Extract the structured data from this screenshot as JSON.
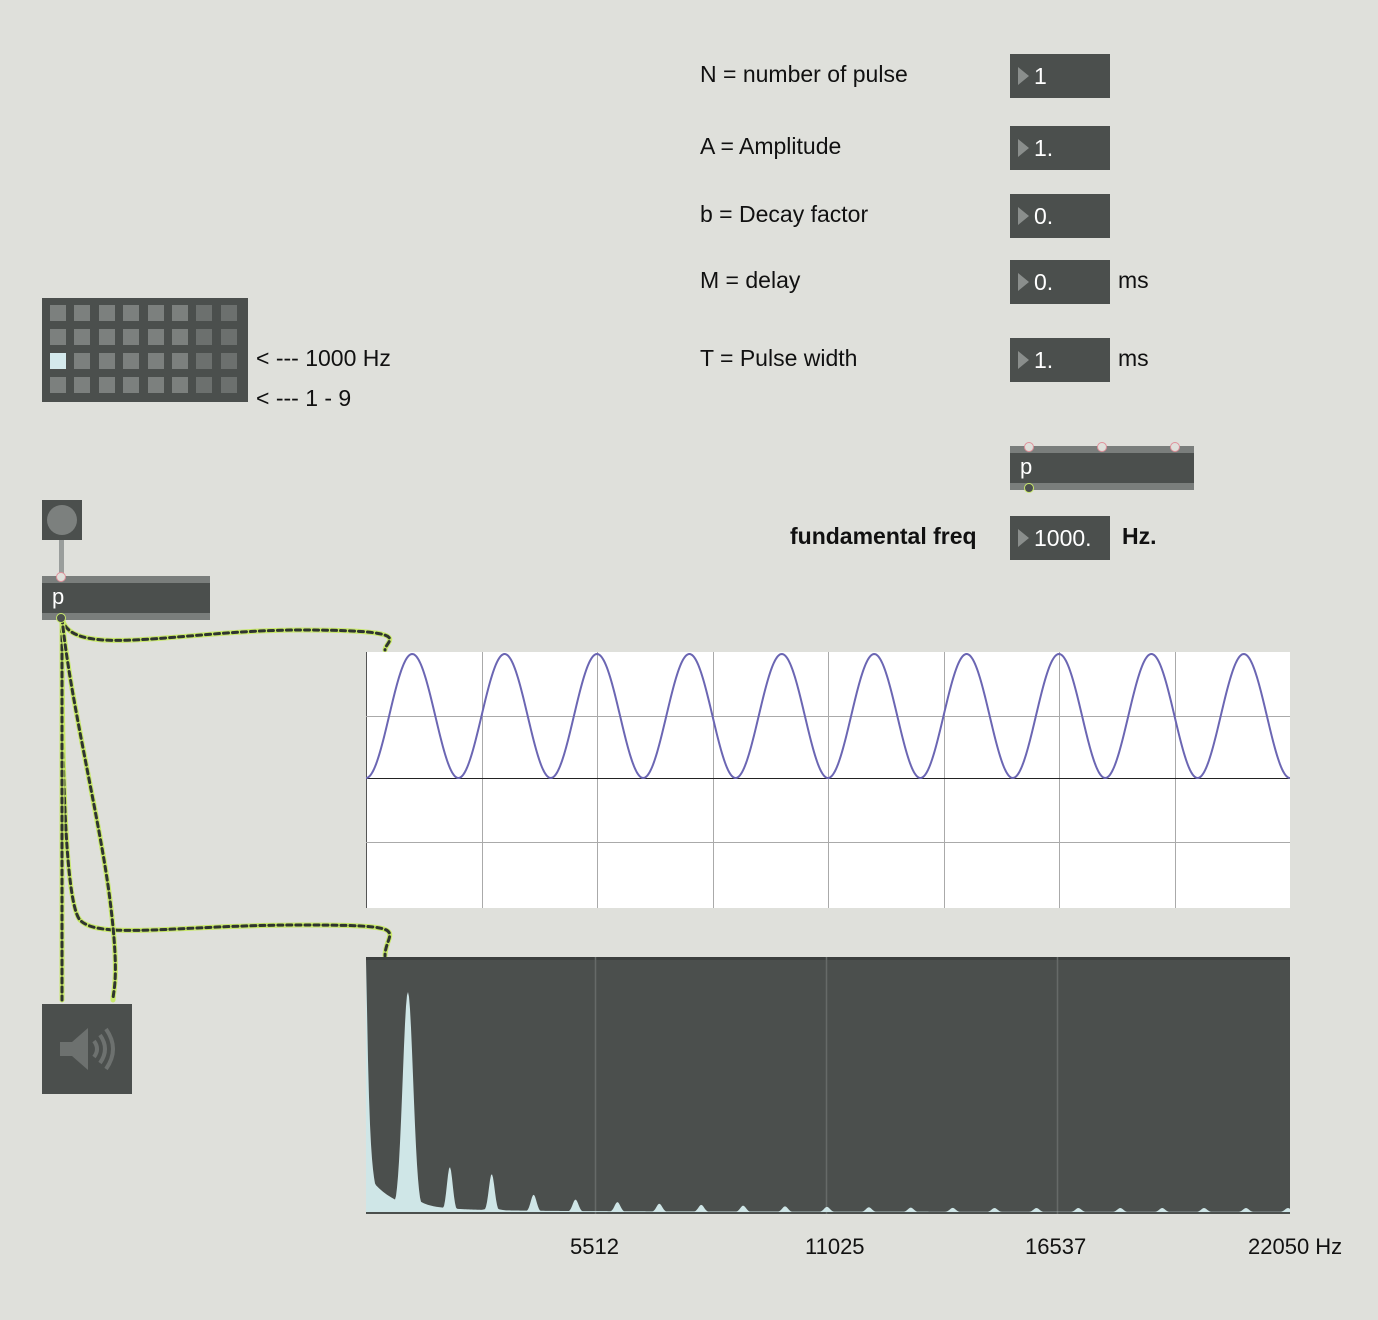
{
  "params": [
    {
      "label": "N = number of pulse",
      "value": "1",
      "unit": ""
    },
    {
      "label": "A = Amplitude",
      "value": "1.",
      "unit": ""
    },
    {
      "label": "b = Decay factor",
      "value": "0.",
      "unit": ""
    },
    {
      "label": "M = delay",
      "value": "0.",
      "unit": "ms"
    },
    {
      "label": "T = Pulse width",
      "value": "1.",
      "unit": "ms"
    }
  ],
  "fundamental": {
    "label": "fundamental freq",
    "value": "1000.",
    "unit": "Hz."
  },
  "subpatcher_label": "p",
  "matrix": {
    "rows": 4,
    "cols": 8,
    "active_row": 2,
    "active_col": 0
  },
  "matrix_notes": [
    "< --- 1000 Hz",
    "< --- 1 - 9"
  ],
  "scope": {
    "cycles": 10,
    "ylim": [
      -1,
      1
    ],
    "line_color": "#6b66b3"
  },
  "spectrum": {
    "fill_color": "#cfe6e7",
    "background": "#4b4f4d",
    "axis_labels": [
      "5512",
      "11025",
      "16537",
      "22050 Hz"
    ],
    "fundamental_hz": 1000,
    "max_hz": 22050
  },
  "colors": {
    "patch_cord": "#c8e86a",
    "background": "#dfe0db"
  }
}
